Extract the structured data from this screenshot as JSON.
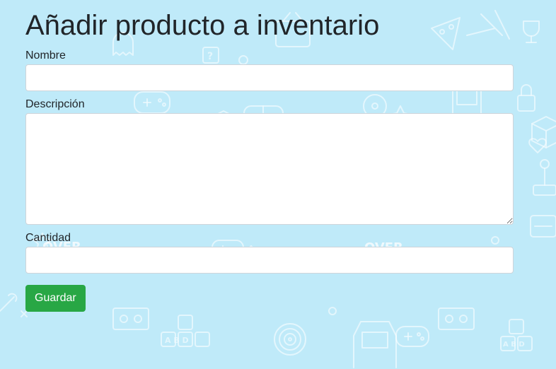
{
  "page": {
    "title": "Añadir producto a inventario"
  },
  "form": {
    "name_label": "Nombre",
    "name_value": "",
    "description_label": "Descripción",
    "description_value": "",
    "quantity_label": "Cantidad",
    "quantity_value": "",
    "save_label": "Guardar"
  },
  "background": {
    "pattern_text_1": "OVER",
    "pattern_text_2": "OVER",
    "pattern_text_3": "A B D",
    "pattern_text_4": "A B D"
  },
  "colors": {
    "background": "#bfeaf9",
    "save_button": "#28a745",
    "text": "#212529"
  }
}
